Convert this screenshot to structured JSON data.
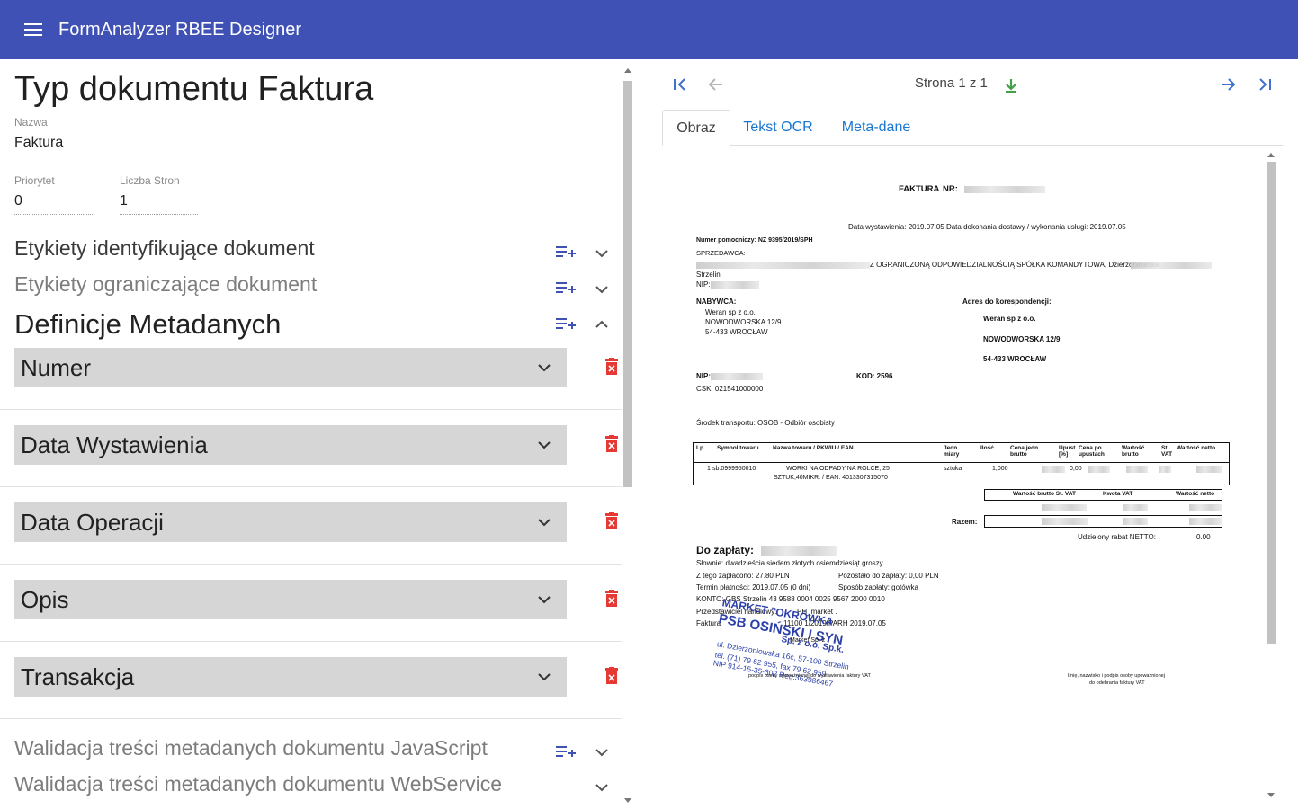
{
  "app": {
    "title": "FormAnalyzer RBEE Designer"
  },
  "left": {
    "title": "Typ dokumentu Faktura",
    "name_label": "Nazwa",
    "name_value": "Faktura",
    "priority_label": "Priorytet",
    "priority_value": "0",
    "pages_label": "Liczba Stron",
    "pages_value": "1",
    "sections": {
      "identifying": "Etykiety identyfikujące dokument",
      "limiting": "Etykiety ograniczające dokument",
      "metadata": "Definicje Metadanych",
      "js_validation": "Walidacja treści metadanych dokumentu JavaScript",
      "ws_validation": "Walidacja treści metadanych dokumentu WebService"
    },
    "metadata_items": [
      "Numer",
      "Data Wystawienia",
      "Data Operacji",
      "Opis",
      "Transakcja"
    ]
  },
  "viewer": {
    "page_info": "Strona 1 z 1",
    "tabs": [
      "Obraz",
      "Tekst OCR",
      "Meta-dane"
    ],
    "active_tab": "Obraz"
  },
  "invoice": {
    "title": "FAKTURA",
    "nr_label": "NR:",
    "dates": "Data wystawienia: 2019.07.05     Data dokonania dostawy / wykonania usługi: 2019.07.05",
    "aux_number": "Numer pomocniczy: NZ 9395/2019/SPH",
    "seller_label": "SPRZEDAWCA:",
    "seller_text": "Z OGRANICZONĄ ODPOWIEDZIALNOŚCIĄ SPÓŁKA KOMANDYTOWA, Dzierżoniowska",
    "seller_city": "Strzelin",
    "nip_label": "NIP:",
    "buyer_label": "NABYWCA:",
    "buyer_lines": [
      "Weran sp z o.o.",
      "NOWODWORSKA 12/9",
      "54-433 WROCŁAW"
    ],
    "corr_label": "Adres do korespondencji:",
    "corr_lines": [
      "Weran sp z o.o.",
      "NOWODWORSKA 12/9",
      "54-433 WROCŁAW"
    ],
    "nip2_label": "NIP:",
    "kod": "KOD: 2596",
    "csk": "CSK: 021541000000",
    "transport": "Środek transportu: OSOB - Odbiór osobisty",
    "table_headers": [
      "Lp.",
      "Symbol towaru",
      "Nazwa towaru / PKWIU / EAN",
      "Jedn. miary",
      "Ilość",
      "Cena jedn. brutto",
      "Upust [%]",
      "Cena po upustach",
      "Wartość brutto",
      "St. VAT",
      "Wartość netto"
    ],
    "row": {
      "lp": "1",
      "symbol": "sb.0999950010",
      "name1": "WORKI NA ODPADY NA ROLCE, 25",
      "name2": "SZTUK,40MIKR. / EAN: 4013307315070",
      "unit": "sztuka",
      "qty": "1,000",
      "discount": "0,00"
    },
    "sum_headers": [
      "Wartość brutto St. VAT",
      "Kwota VAT",
      "Wartość netto"
    ],
    "razem": "Razem:",
    "rabat_label": "Udzielony rabat NETTO:",
    "rabat_value": "0.00",
    "do_zaplaty": "Do zapłaty:",
    "slownie": "Słownie: dwadzieścia siedem złotych osiemdziesiąt groszy",
    "zaplacono": "Z tego zapłacono: 27.80 PLN",
    "pozostalo": "Pozostało do zapłaty: 0,00 PLN",
    "termin": "Termin płatności: 2019.07.05 (0 dni)",
    "sposob": "Sposób zapłaty: gotówka",
    "konto": "KONTO: GBS Strzelin 43 9588 0004 0025 9567 2000 0010",
    "przedstawiciel": "Przedstawiciel handlowy:",
    "przedstawiciel_value": "PH_market .",
    "faktura_ref": "Faktura",
    "faktura_ref_value": "11100 1/2019/PARH 2019.07.05",
    "sig_left": "podpis osoby upoważnionej do wystawienia faktury VAT",
    "sig_right1": "Imię, nazwisko i podpis osoby upoważnionej",
    "sig_right2": "do odebrania faktury VAT",
    "stamp_lines": [
      "MARKET \"OKRÓWKA",
      "PSB OSIŃSKI I SYN",
      "Sp. z o.o. Sp.k.",
      "ul. Dzierżoniowska 16c, 57-100 Strzelin",
      "tel. (71) 79 62 955, fax 79 62 959",
      "NIP 914-15-35-302 Reg.363986467"
    ],
    "stamp_small": "Market Sp. z"
  },
  "colors": {
    "appbar": "#3f51b5",
    "link": "#1976d2",
    "add_icon": "#3f51b5",
    "delete_icon": "#e53935",
    "download_icon": "#43a047"
  }
}
